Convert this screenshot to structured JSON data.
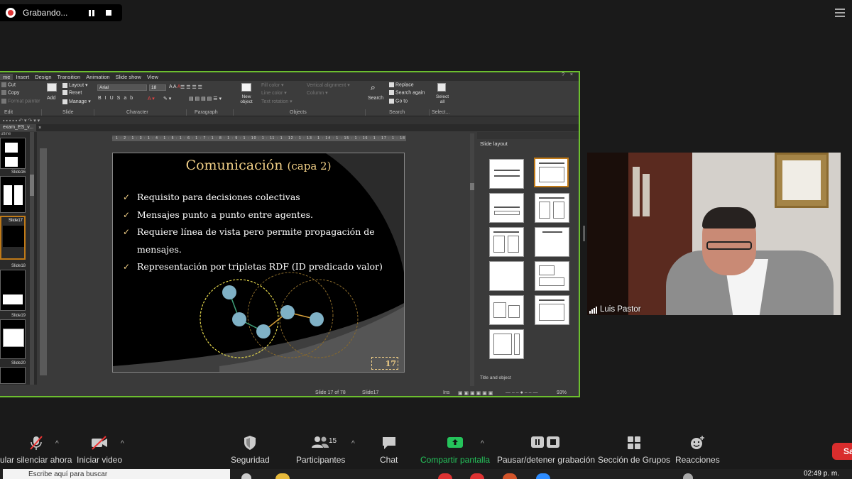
{
  "recording": {
    "label": "Grabando..."
  },
  "app": {
    "menu": [
      "me",
      "Insert",
      "Design",
      "Transition",
      "Animation",
      "Slide show",
      "View"
    ],
    "help": "?",
    "close": "×",
    "ribbon": {
      "cut": "Cut",
      "copy": "Copy",
      "format_painter": "Format painter",
      "add": "Add",
      "layout": "Layout",
      "reset": "Reset",
      "manage": "Manage",
      "font_name": "Arial",
      "font_size": "18",
      "new_object": "New object",
      "fill_color": "Fill color",
      "line_color": "Line color",
      "text_rotation": "Text rotation",
      "vertical_alignment": "Vertical alignment",
      "column": "Column",
      "search": "Search",
      "replace": "Replace",
      "search_again": "Search again",
      "go_to": "Go to",
      "select_all": "Select all",
      "groups": [
        "Edit",
        "Slide",
        "Character",
        "Paragraph",
        "Objects",
        "Search",
        "Select..."
      ]
    },
    "document_tab": "exam_ES_v...",
    "thumb_header": "utline",
    "thumb_labels": [
      "Slide16",
      "Slide17",
      "Slide18",
      "Slide19",
      "Slide20"
    ],
    "ruler_marks": "· 1 · 2 · 1 · 3 · 1 · 4 · 1 · 5 · 1 · 6 · 1 · 7 · 1 · 8 · 1 · 9 · 1 · 10 · 1 · 11 · 1 · 12 · 1 · 13 · 1 · 14 · 1 · 15 · 1 · 16 · 1 · 17 · 1 · 18 · 1 · 19 · 1 · 20 · 1 · 21 · 1 · 22 · 1 · 23 · 1 · 24 · 1 · 25",
    "slide": {
      "title": "Comunicación",
      "title_suffix": "(capa 2)",
      "bullets": [
        "Requisito para decisiones colectivas",
        "Mensajes punto a punto entre agentes.",
        "Requiere línea de vista pero permite propagación de",
        "mensajes.",
        "Representación por tripletas RDF (ID predicado valor)"
      ],
      "bullet_marks": [
        "✓",
        "✓",
        "✓",
        "",
        "✓"
      ],
      "page_number": "17"
    },
    "right_panel": {
      "title": "Slide layout",
      "footer": "Title and object"
    },
    "status": {
      "position": "Slide 17 of 78",
      "slide_name": "Slide17",
      "mode": "Ins",
      "zoom": "93%"
    }
  },
  "video": {
    "participant_name": "Luis Pastor"
  },
  "controls": {
    "mute": "ular silenciar ahora",
    "start_video": "Iniciar video",
    "security": "Seguridad",
    "participants": "Participantes",
    "participants_count": "15",
    "chat": "Chat",
    "share_screen": "Compartir pantalla",
    "pause_recording": "Pausar/detener grabación",
    "breakout_rooms": "Sección de Grupos",
    "reactions": "Reacciones",
    "leave": "Sa"
  },
  "taskbar": {
    "search_text": "Escribe aquí para buscar",
    "time": "02:49 p. m."
  },
  "colors": {
    "share_border": "#6cbf2f",
    "slide_title": "#f1cf86",
    "node": "#7fb1c6",
    "leave": "#d92d2d",
    "share_green": "#25c35b"
  }
}
